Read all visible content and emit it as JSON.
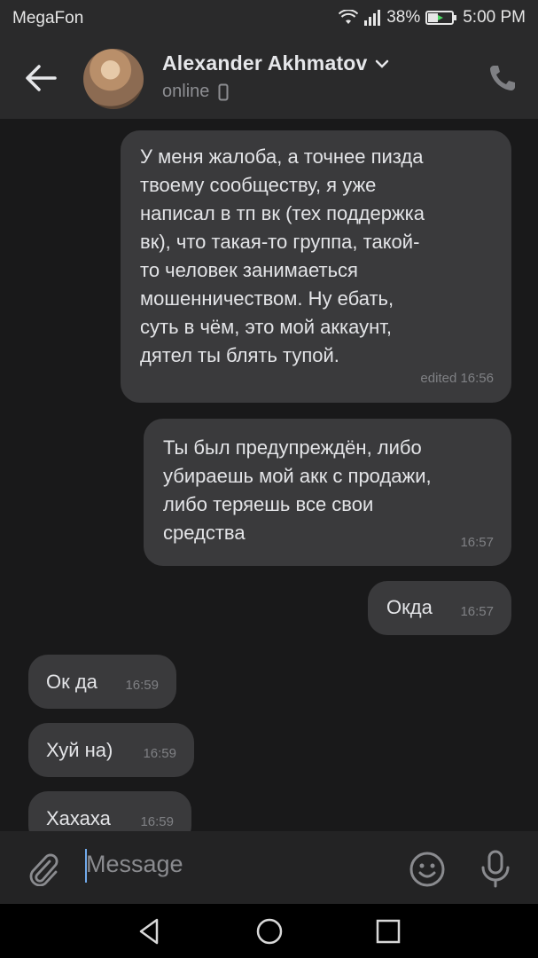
{
  "status_bar": {
    "carrier": "MegaFon",
    "battery": "38%",
    "time": "5:00 PM"
  },
  "header": {
    "name": "Alexander Akhmatov",
    "status": "online"
  },
  "messages": [
    {
      "side": "out",
      "lines": [
        "У меня жалоба, а точнее пизда",
        "твоему сообществу, я уже",
        "написал в тп вк (тех поддержка",
        "вк), что такая-то группа, такой-",
        "то человек занимаеться",
        "мошенничеством. Ну ебать,",
        "суть в чём, это мой аккаунт,",
        "дятел ты блять тупой."
      ],
      "time": "edited 16:56"
    },
    {
      "side": "out",
      "lines": [
        "Ты был предупреждён, либо",
        "убираешь мой акк с продажи,",
        "либо теряешь все свои",
        "средства"
      ],
      "time": "16:57"
    },
    {
      "side": "out",
      "lines": [
        "Окда"
      ],
      "time": "16:57"
    },
    {
      "side": "in",
      "lines": [
        "Ок да"
      ],
      "time": "16:59"
    },
    {
      "side": "in",
      "lines": [
        "Хуй на)"
      ],
      "time": "16:59"
    },
    {
      "side": "in",
      "lines": [
        "Хахаха"
      ],
      "time": "16:59"
    }
  ],
  "input": {
    "placeholder": "Message"
  },
  "colors": {
    "bubble": "#3a3a3c",
    "background": "#19191a",
    "header": "#2a2a2b",
    "accent": "#71aaeb"
  },
  "icons": [
    "back-arrow-icon",
    "chevron-down-icon",
    "mobile-device-icon",
    "phone-icon",
    "paperclip-icon",
    "emoji-icon",
    "microphone-icon",
    "nav-back-icon",
    "nav-home-icon",
    "nav-recents-icon"
  ]
}
